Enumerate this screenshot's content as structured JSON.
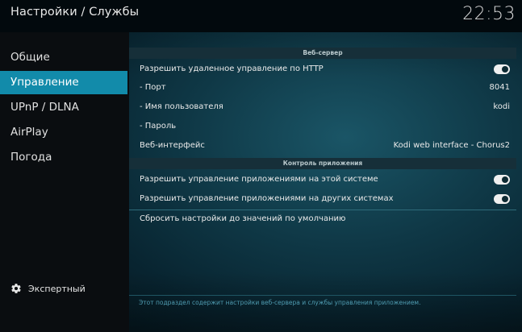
{
  "header": {
    "title": "Настройки / Службы",
    "clock": "22:53"
  },
  "sidebar": {
    "items": [
      {
        "label": "Общие",
        "active": false
      },
      {
        "label": "Управление",
        "active": true
      },
      {
        "label": "UPnP / DLNA",
        "active": false
      },
      {
        "label": "AirPlay",
        "active": false
      },
      {
        "label": "Погода",
        "active": false
      }
    ],
    "expert_label": "Экспертный"
  },
  "sections": {
    "webserver": {
      "title": "Веб-сервер",
      "allow_http": {
        "label": "Разрешить удаленное управление по HTTP",
        "enabled": true
      },
      "port": {
        "label": "- Порт",
        "value": "8041"
      },
      "username": {
        "label": "- Имя пользователя",
        "value": "kodi"
      },
      "password": {
        "label": "- Пароль",
        "value": ""
      },
      "web_interface": {
        "label": "Веб-интерфейс",
        "value": "Kodi web interface - Chorus2"
      }
    },
    "app_control": {
      "title": "Контроль приложения",
      "local": {
        "label": "Разрешить управление приложениями на этой системе",
        "enabled": true
      },
      "remote": {
        "label": "Разрешить управление приложениями на других системах",
        "enabled": true
      }
    },
    "reset": {
      "label": "Сбросить настройки до значений по умолчанию"
    }
  },
  "footer": {
    "hint": "Этот подраздел содержит настройки веб-сервера и службы управления приложением."
  },
  "colors": {
    "accent": "#128baa",
    "background": "#0f3846"
  },
  "icons": {
    "expert": "gear-icon"
  }
}
